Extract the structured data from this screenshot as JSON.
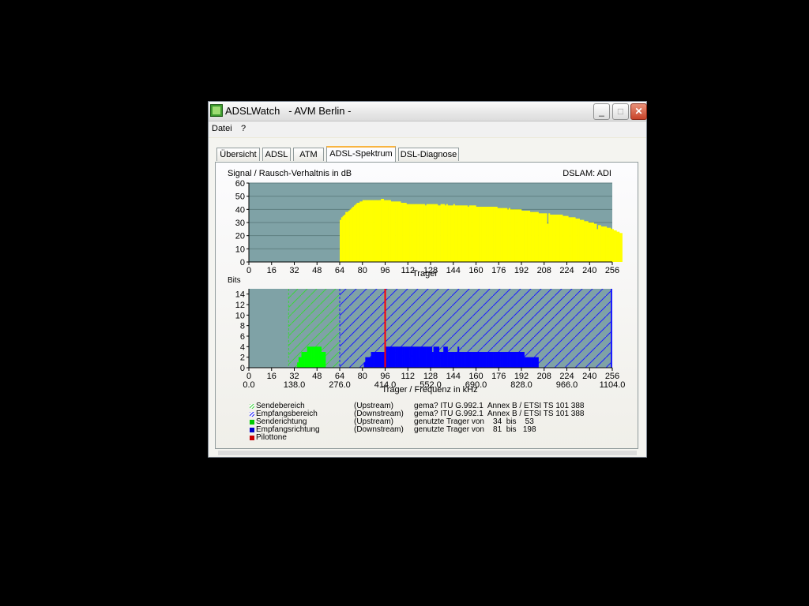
{
  "window": {
    "title": "ADSLWatch   - AVM Berlin -",
    "minimize_label": "_",
    "maximize_label": "□",
    "close_label": "✕"
  },
  "menu": {
    "items": [
      "Datei",
      "?"
    ]
  },
  "tabs": [
    {
      "label": "Übersicht",
      "active": false
    },
    {
      "label": "ADSL",
      "active": false
    },
    {
      "label": "ATM",
      "active": false
    },
    {
      "label": "ADSL-Spektrum",
      "active": true
    },
    {
      "label": "DSL-Diagnose",
      "active": false
    }
  ],
  "snr_chart": {
    "title": "Signal / Rausch-Verhaltnis in dB",
    "dslam_label": "DSLAM: ADI",
    "xlabel": "Trager"
  },
  "bits_chart": {
    "ylabel": "Bits",
    "xlabel": "Trager / Frequenz in kHz"
  },
  "chart_data": [
    {
      "type": "bar",
      "title": "Signal / Rausch-Verhaltnis in dB",
      "xlabel": "Trager",
      "ylabel": "",
      "xlim": [
        0,
        256
      ],
      "ylim": [
        0,
        60
      ],
      "x_ticks": [
        0,
        16,
        32,
        48,
        64,
        80,
        96,
        112,
        128,
        144,
        160,
        176,
        192,
        208,
        224,
        240,
        256
      ],
      "y_ticks": [
        0,
        10,
        20,
        30,
        40,
        50,
        60
      ],
      "grid": true,
      "bar_color": "#ffff00",
      "background_color": "#7fa2a6",
      "series": [
        {
          "x_start": 64,
          "x_end": 252,
          "values": [
            32,
            34,
            35,
            36,
            38,
            38,
            39,
            40,
            41,
            42,
            43,
            44,
            45,
            45,
            46,
            46,
            47,
            47,
            47,
            47,
            47,
            47,
            47,
            47,
            47,
            47,
            47,
            47,
            47,
            48,
            48,
            47,
            47,
            47,
            47,
            47,
            46,
            46,
            46,
            46,
            46,
            46,
            46,
            45,
            45,
            45,
            45,
            44,
            44,
            44,
            44,
            44,
            44,
            44,
            44,
            44,
            44,
            44,
            44,
            44,
            43,
            44,
            44,
            44,
            44,
            44,
            44,
            44,
            44,
            43,
            43,
            44,
            44,
            44,
            43,
            44,
            43,
            43,
            43,
            43,
            44,
            43,
            43,
            43,
            43,
            43,
            43,
            43,
            43,
            43,
            42,
            43,
            43,
            43,
            43,
            43,
            42,
            42,
            42,
            42,
            42,
            42,
            42,
            42,
            42,
            42,
            42,
            42,
            42,
            42,
            42,
            41,
            41,
            41,
            41,
            41,
            41,
            41,
            40,
            41,
            40,
            40,
            40,
            40,
            40,
            40,
            40,
            40,
            39,
            39,
            39,
            39,
            39,
            39,
            38,
            38,
            38,
            38,
            38,
            38,
            37,
            37,
            37,
            37,
            37,
            37,
            29,
            37,
            36,
            36,
            36,
            36,
            36,
            36,
            36,
            36,
            36,
            35,
            35,
            35,
            35,
            34,
            34,
            34,
            34,
            34,
            33,
            33,
            33,
            32,
            32,
            32,
            31,
            31,
            31,
            30,
            30,
            30,
            30,
            29,
            29,
            25,
            28,
            28,
            27,
            27,
            27,
            27,
            26,
            26,
            26,
            25,
            25,
            24,
            24,
            23,
            23,
            22,
            22
          ]
        }
      ]
    },
    {
      "type": "bar",
      "ylabel": "Bits",
      "xlabel": "Trager / Frequenz in kHz",
      "xlim": [
        0,
        256
      ],
      "ylim": [
        0,
        15
      ],
      "x_ticks": [
        0,
        16,
        32,
        48,
        64,
        80,
        96,
        112,
        128,
        144,
        160,
        176,
        192,
        208,
        224,
        240,
        256
      ],
      "freq_ticks": [
        "0.0",
        "138.0",
        "276.0",
        "414.0",
        "552.0",
        "690.0",
        "828.0",
        "966.0",
        "1104.0"
      ],
      "y_ticks": [
        0,
        2,
        4,
        6,
        8,
        10,
        12,
        14
      ],
      "background_color": "#7fa2a6",
      "regions": [
        {
          "name": "Sendebereich",
          "x_start": 28,
          "x_end": 64,
          "color": "#3cd43c"
        },
        {
          "name": "Empfangsbereich",
          "x_start": 64,
          "x_end": 256,
          "color": "#1c1cff"
        }
      ],
      "series": [
        {
          "name": "Senderichtung",
          "color": "#00ff00",
          "x_start": 34,
          "values": [
            1,
            2,
            2,
            3,
            3,
            3,
            3,
            4,
            4,
            4,
            4,
            4,
            4,
            4,
            4,
            4,
            4,
            3,
            3,
            3
          ]
        },
        {
          "name": "Empfangsrichtung",
          "color": "#0000ff",
          "x_start": 81,
          "values": [
            1,
            2,
            2,
            2,
            2,
            3,
            3,
            3,
            3,
            3,
            3,
            3,
            3,
            3,
            3,
            4,
            4,
            4,
            4,
            4,
            4,
            4,
            4,
            4,
            4,
            4,
            4,
            4,
            4,
            4,
            4,
            4,
            4,
            4,
            4,
            4,
            4,
            4,
            4,
            4,
            4,
            4,
            4,
            4,
            4,
            4,
            4,
            4,
            3,
            4,
            4,
            4,
            4,
            3,
            3,
            3,
            4,
            4,
            4,
            3,
            3,
            3,
            3,
            3,
            3,
            3,
            4,
            3,
            3,
            3,
            3,
            3,
            3,
            3,
            3,
            3,
            3,
            3,
            3,
            3,
            3,
            3,
            3,
            3,
            3,
            3,
            3,
            3,
            3,
            3,
            3,
            3,
            3,
            3,
            3,
            3,
            3,
            3,
            3,
            3,
            3,
            3,
            3,
            3,
            3,
            3,
            3,
            3,
            3,
            3,
            3,
            3,
            3,
            2,
            2,
            2,
            2,
            2,
            2,
            2,
            2,
            2,
            2
          ]
        },
        {
          "name": "Pilottone",
          "color": "#ff0000",
          "x": 96
        }
      ]
    }
  ],
  "legend": [
    {
      "symbol": "hatch-green",
      "name": "Sendebereich",
      "direction": "(Upstream)",
      "desc": "gema? ITU G.992.1  Annex B / ETSI TS 101 388"
    },
    {
      "symbol": "hatch-blue",
      "name": "Empfangsbereich",
      "direction": "(Downstream)",
      "desc": "gema? ITU G.992.1  Annex B / ETSI TS 101 388"
    },
    {
      "symbol": "solid-green",
      "name": "Senderichtung",
      "direction": "(Upstream)",
      "desc": "genutzte Trager von    34  bis    53"
    },
    {
      "symbol": "solid-blue",
      "name": "Empfangsrichtung",
      "direction": "(Downstream)",
      "desc": "genutzte Trager von    81  bis   198"
    },
    {
      "symbol": "solid-red",
      "name": "Pilottone",
      "direction": "",
      "desc": ""
    }
  ]
}
